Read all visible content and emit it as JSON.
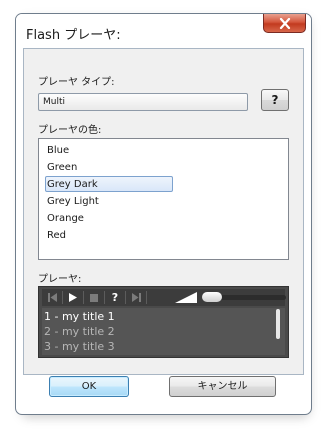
{
  "window": {
    "title": "Flash プレーヤ:"
  },
  "player_type": {
    "label": "プレーヤ タイプ:",
    "selected": "Multi",
    "help_label": "?"
  },
  "player_color": {
    "label": "プレーヤの色:",
    "options": [
      "Blue",
      "Green",
      "Grey Dark",
      "Grey Light",
      "Orange",
      "Red"
    ],
    "selected": "Grey Dark"
  },
  "player_preview": {
    "label": "プレーヤ:",
    "controls": [
      "previous-icon",
      "play-icon",
      "stop-icon",
      "help-icon",
      "next-icon",
      "volume-icon"
    ],
    "help_glyph": "?",
    "tracks": [
      "1 - my title 1",
      "2 - my title 2",
      "3 - my title 3"
    ],
    "active_track": 0
  },
  "buttons": {
    "ok_label": "OK",
    "cancel_label": "キャンセル"
  },
  "colors": {
    "player_bg": "#4a4a4a",
    "close_button": "#c23a1f",
    "selection": "#d9e7f9"
  }
}
